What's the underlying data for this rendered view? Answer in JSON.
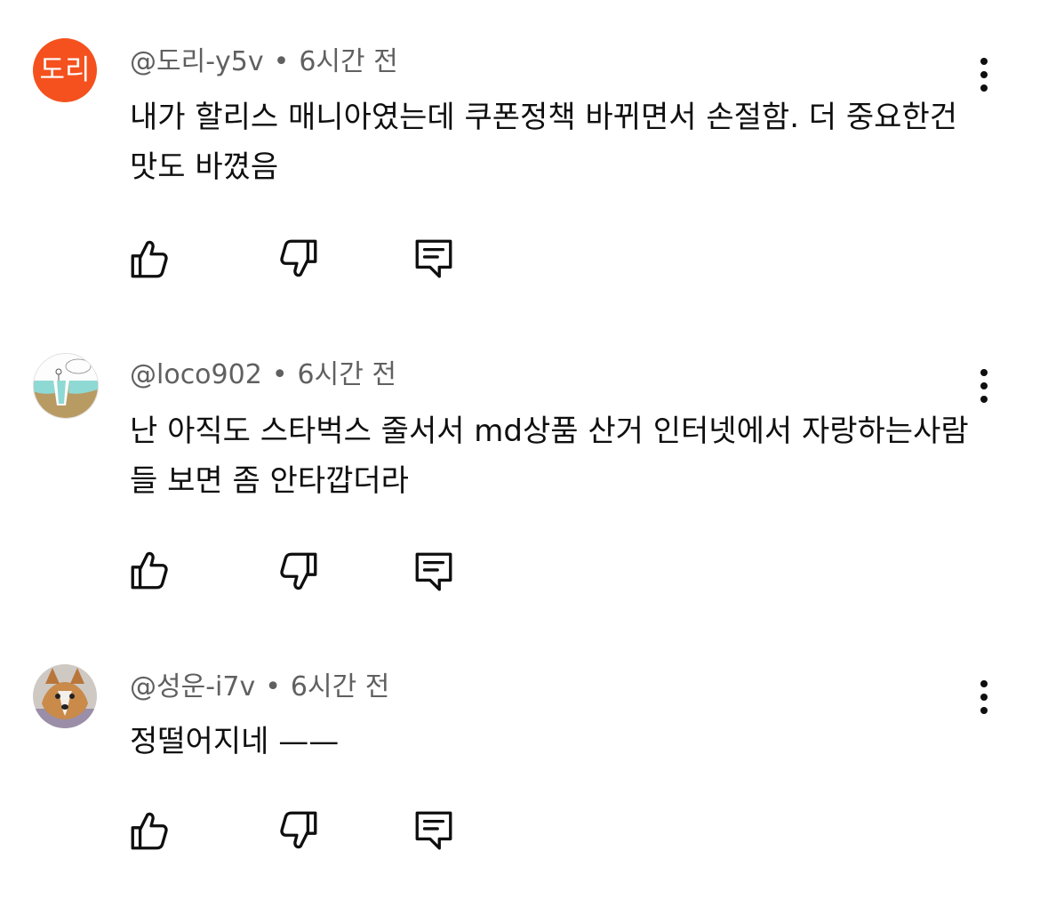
{
  "comments": [
    {
      "avatar_text": "도리",
      "avatar_color": "#f4511e",
      "author": "@도리-y5v",
      "separator": "•",
      "time": "6시간 전",
      "text": "내가 할리스 매니아였는데 쿠폰정책  바뀌면서 손절함. 더 중요한건 맛도 바꼈음",
      "actions": [
        "like-icon",
        "dislike-icon",
        "reply-icon"
      ],
      "menu_icon": "more-vert-icon"
    },
    {
      "avatar_image": "sketch-drawing",
      "author": "@loco902",
      "separator": "•",
      "time": "6시간 전",
      "text": "난 아직도 스타벅스 줄서서 md상품 산거 인터넷에서 자랑하는사람들 보면 좀 안타깝더라",
      "actions": [
        "like-icon",
        "dislike-icon",
        "reply-icon"
      ],
      "menu_icon": "more-vert-icon"
    },
    {
      "avatar_image": "corgi-dog-photo",
      "author": "@성운-i7v",
      "separator": "•",
      "time": "6시간 전",
      "text": "정떨어지네 ——",
      "actions": [
        "like-icon",
        "dislike-icon",
        "reply-icon"
      ],
      "menu_icon": "more-vert-icon"
    }
  ]
}
